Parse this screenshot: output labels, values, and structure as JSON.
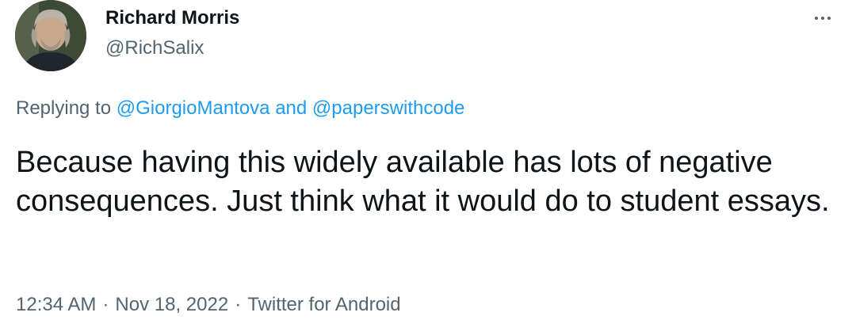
{
  "author": {
    "display_name": "Richard Morris",
    "handle": "@RichSalix"
  },
  "more_icon": "more-horizontal-icon",
  "reply_context": {
    "prefix": "Replying to ",
    "mention_1": "@GiorgioMantova",
    "conjunction": " and ",
    "mention_2": "@paperswithcode"
  },
  "tweet_text": "Because having this widely available has lots of negative consequences. Just think what it would do to student essays.",
  "meta": {
    "time": "12:34 AM",
    "separator": "·",
    "date": "Nov 18, 2022",
    "source": "Twitter for Android"
  },
  "colors": {
    "link": "#1d9bf0",
    "secondary": "#536471",
    "primary": "#0f1419"
  }
}
